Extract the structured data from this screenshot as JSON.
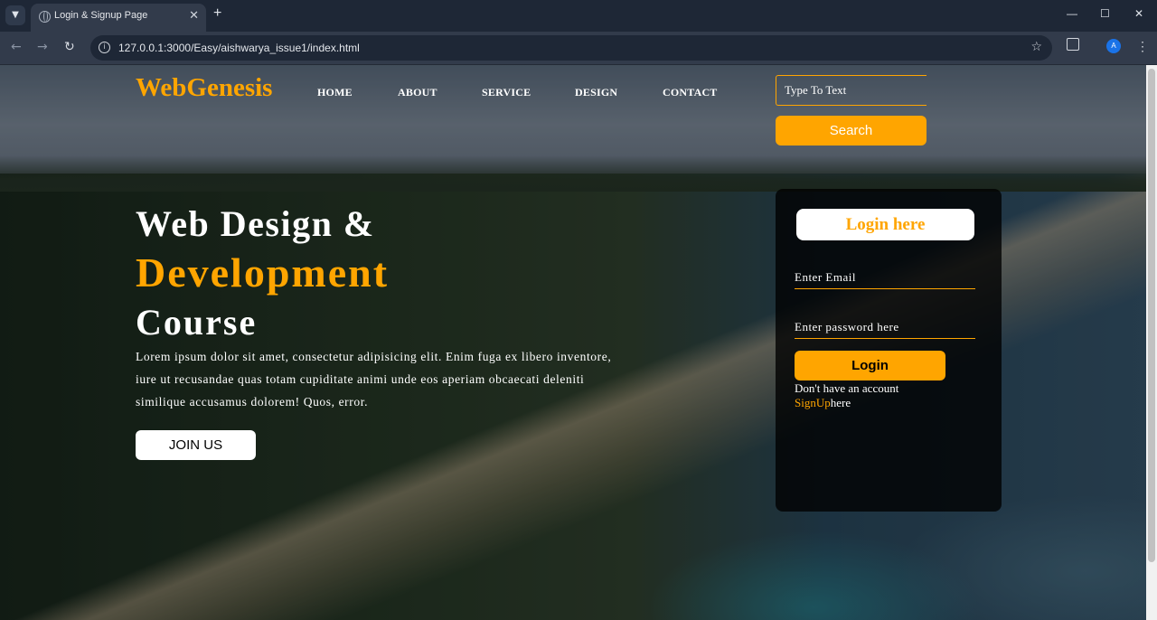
{
  "browser": {
    "tab_title": "Login & Signup Page",
    "url": "127.0.0.1:3000/Easy/aishwarya_issue1/index.html",
    "profile_initial": "A"
  },
  "site": {
    "logo": "WebGenesis",
    "nav": [
      "HOME",
      "ABOUT",
      "SERVICE",
      "DESIGN",
      "CONTACT"
    ],
    "search_placeholder": "Type To Text",
    "search_button": "Search",
    "hero": {
      "line1": "Web Design &",
      "line2": "Development",
      "line3": "Course",
      "paragraph": "Lorem ipsum dolor sit amet, consectetur adipisicing elit. Enim fuga ex libero inventore, iure ut recusandae quas totam cupiditate animi unde eos aperiam obcaecati deleniti similique accusamus dolorem! Quos, error.",
      "join_button": "JOIN US"
    },
    "login": {
      "title": "Login here",
      "email_placeholder": "Enter Email",
      "password_placeholder": "Enter password here",
      "button": "Login",
      "no_account_text": "Don't have an account",
      "signup_link": "SignUp",
      "signup_suffix": "here"
    }
  },
  "colors": {
    "accent": "#ffa500",
    "card_background": "#000000"
  }
}
